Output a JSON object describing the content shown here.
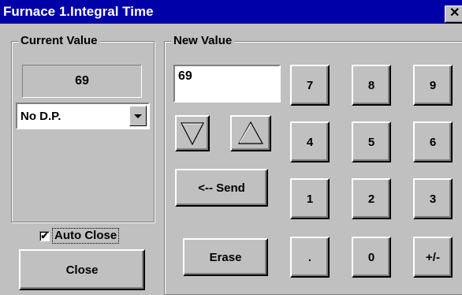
{
  "window": {
    "title": "Furnace 1.Integral Time",
    "close_glyph": "✕"
  },
  "current_value": {
    "label": "Current Value",
    "value": "69",
    "decimal_selected": "No D.P.",
    "auto_close_label": "Auto Close",
    "auto_close_checked": true,
    "close_label": "Close"
  },
  "new_value": {
    "label": "New Value",
    "input_value": "69",
    "send_label": "<-- Send",
    "erase_label": "Erase",
    "keys": {
      "k7": "7",
      "k8": "8",
      "k9": "9",
      "k4": "4",
      "k5": "5",
      "k6": "6",
      "k1": "1",
      "k2": "2",
      "k3": "3",
      "dot": ".",
      "k0": "0",
      "sign": "+/-"
    },
    "decrement_icon": "triangle-down-icon",
    "increment_icon": "triangle-up-icon"
  },
  "colors": {
    "titlebar": "#0000a8",
    "face": "#c0c0c0"
  }
}
